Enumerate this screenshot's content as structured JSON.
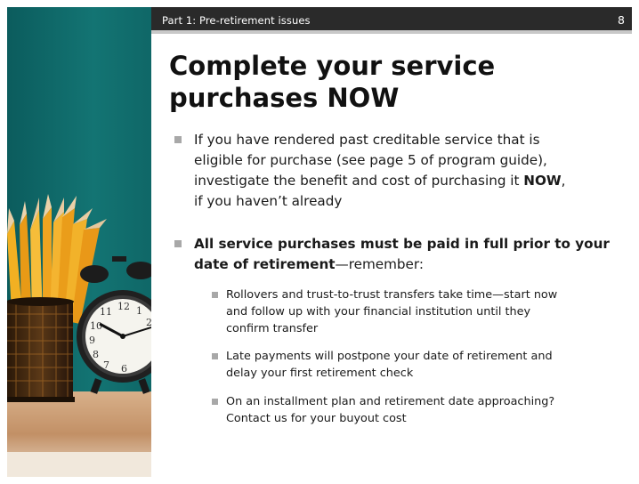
{
  "header": {
    "section": "Part 1: Pre-retirement issues",
    "page_number": "8"
  },
  "title": {
    "line1": "Complete your service",
    "line2": "purchases NOW"
  },
  "bullets": {
    "b1": {
      "line1": "If you have rendered past creditable service that is",
      "line2": "eligible for purchase (see page 5 of program guide),",
      "line3_pre": "investigate the benefit and cost of purchasing it ",
      "line3_bold": "NOW",
      "line3_post": ",",
      "line4": "if you haven’t already"
    },
    "b2": {
      "line1": "All service purchases must be paid in full prior to your",
      "line2_bold": "date of retirement",
      "line2_post": "—remember:"
    },
    "sub1": {
      "line1": "Rollovers and trust-to-trust transfers take time—start now",
      "line2": "and follow up with your financial institution until they",
      "line3": "confirm transfer"
    },
    "sub2": {
      "line1": "Late payments will postpone your date of retirement and",
      "line2": "delay your first retirement check"
    },
    "sub3": {
      "line1": "On an installment plan and retirement date approaching?",
      "line2": "Contact us for your buyout cost"
    }
  },
  "photo": {
    "clock_numerals": [
      "12",
      "1",
      "2",
      "10",
      "9",
      "8",
      "7",
      "6",
      "11"
    ],
    "colors": {
      "wall": "#0f6a6a",
      "desk": "#c89a6e",
      "pencil": "#f0a81c",
      "cup": "#3a2410"
    }
  },
  "colors": {
    "header_bg": "#2a2a2a",
    "header_text": "#ffffff",
    "bullet_marker": "#a8a8a8",
    "title_text": "#111111"
  }
}
